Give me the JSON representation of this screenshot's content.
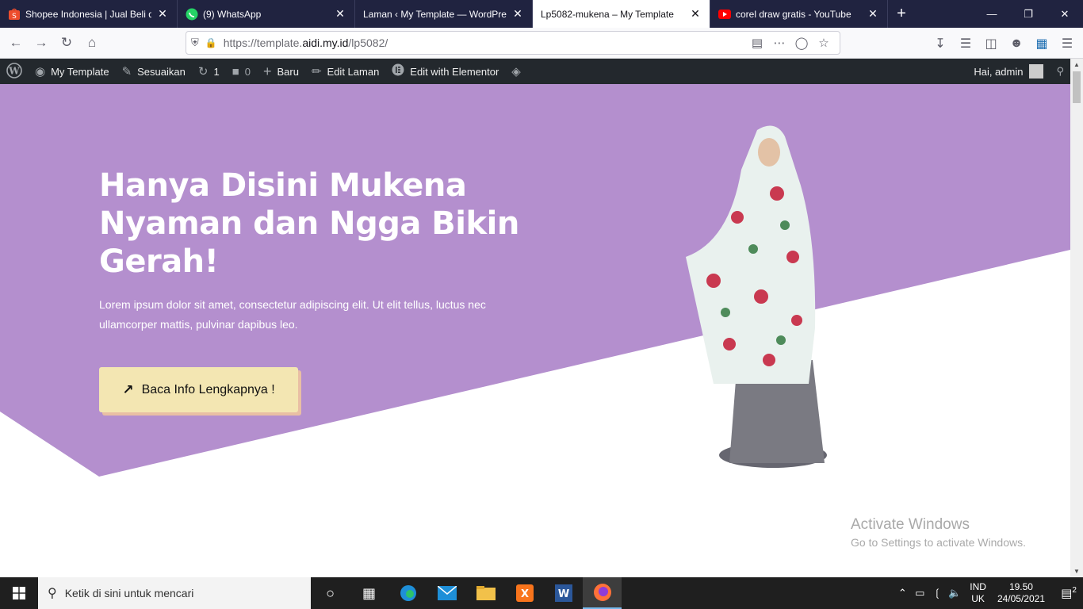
{
  "browser": {
    "tabs": [
      {
        "title": "Shopee Indonesia | Jual Beli di Ponsel",
        "icon": "shopee-icon",
        "active": false
      },
      {
        "title": "(9) WhatsApp",
        "icon": "whatsapp-icon",
        "active": false
      },
      {
        "title": "Laman ‹ My Template — WordPress",
        "icon": "none",
        "active": false
      },
      {
        "title": "Lp5082-mukena – My Template",
        "icon": "none",
        "active": true
      },
      {
        "title": "corel draw gratis - YouTube",
        "icon": "youtube-icon",
        "active": false
      }
    ],
    "close_symbol": "✕",
    "new_tab_symbol": "+",
    "url_prefix": "https://template.",
    "url_domain": "aidi.my.id",
    "url_path": "/lp5082/"
  },
  "wp_admin_bar": {
    "site_name": "My Template",
    "customize": "Sesuaikan",
    "updates_count": "1",
    "comments_count": "0",
    "new_label": "Baru",
    "edit_page": "Edit Laman",
    "edit_elementor": "Edit with Elementor",
    "greeting": "Hai, admin"
  },
  "hero": {
    "title": "Hanya Disini Mukena Nyaman dan Ngga Bikin Gerah!",
    "description": "Lorem ipsum dolor sit amet, consectetur adipiscing elit. Ut elit tellus, luctus nec ullamcorper mattis, pulvinar dapibus leo.",
    "cta_label": "Baca Info Lengkapnya !",
    "colors": {
      "background": "#b48fce",
      "button": "#f3e6b2",
      "button_shadow": "#e9bfa4"
    }
  },
  "watermark": {
    "line1": "Activate Windows",
    "line2": "Go to Settings to activate Windows."
  },
  "taskbar": {
    "search_placeholder": "Ketik di sini untuk mencari",
    "lang_top": "IND",
    "lang_bottom": "UK",
    "time": "19.50",
    "date": "24/05/2021",
    "notification_count": "2"
  }
}
